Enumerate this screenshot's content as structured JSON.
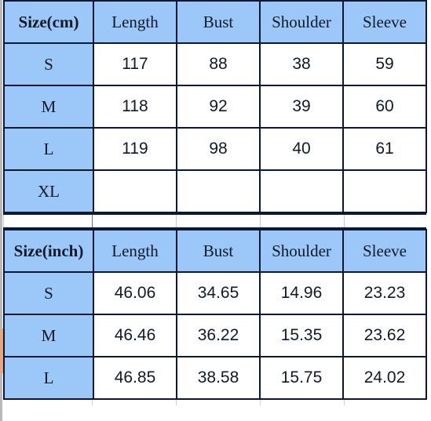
{
  "chart_data": {
    "type": "table",
    "title": "Garment size chart",
    "tables": [
      {
        "unit": "cm",
        "columns": [
          "Size(cm)",
          "Length",
          "Bust",
          "Shoulder",
          "Sleeve"
        ],
        "rows": [
          {
            "size": "S",
            "length": "117",
            "bust": "88",
            "shoulder": "38",
            "sleeve": "59"
          },
          {
            "size": "M",
            "length": "118",
            "bust": "92",
            "shoulder": "39",
            "sleeve": "60"
          },
          {
            "size": "L",
            "length": "119",
            "bust": "98",
            "shoulder": "40",
            "sleeve": "61"
          },
          {
            "size": "XL",
            "length": "",
            "bust": "",
            "shoulder": "",
            "sleeve": ""
          }
        ]
      },
      {
        "unit": "inch",
        "columns": [
          "Size(inch)",
          "Length",
          "Bust",
          "Shoulder",
          "Sleeve"
        ],
        "rows": [
          {
            "size": "S",
            "length": "46.06",
            "bust": "34.65",
            "shoulder": "14.96",
            "sleeve": "23.23"
          },
          {
            "size": "M",
            "length": "46.46",
            "bust": "36.22",
            "shoulder": "15.35",
            "sleeve": "23.62"
          },
          {
            "size": "L",
            "length": "46.85",
            "bust": "38.58",
            "shoulder": "15.75",
            "sleeve": "24.02"
          }
        ]
      }
    ],
    "colors": {
      "header_fill": "#9bc8f8",
      "cell_fill": "#ffffff",
      "border": "#0a1833",
      "row_marker": "#e8a87c",
      "gutter": "#b9b9b9"
    }
  },
  "cm_table": {
    "header": {
      "size": "Size(cm)",
      "length": "Length",
      "bust": "Bust",
      "shoulder": "Shoulder",
      "sleeve": "Sleeve"
    },
    "rows": [
      {
        "size": "S",
        "length": "117",
        "bust": "88",
        "shoulder": "38",
        "sleeve": "59"
      },
      {
        "size": "M",
        "length": "118",
        "bust": "92",
        "shoulder": "39",
        "sleeve": "60"
      },
      {
        "size": "L",
        "length": "119",
        "bust": "98",
        "shoulder": "40",
        "sleeve": "61"
      },
      {
        "size": "XL",
        "length": "",
        "bust": "",
        "shoulder": "",
        "sleeve": ""
      }
    ]
  },
  "inch_table": {
    "header": {
      "size": "Size(inch)",
      "length": "Length",
      "bust": "Bust",
      "shoulder": "Shoulder",
      "sleeve": "Sleeve"
    },
    "rows": [
      {
        "size": "S",
        "length": "46.06",
        "bust": "34.65",
        "shoulder": "14.96",
        "sleeve": "23.23"
      },
      {
        "size": "M",
        "length": "46.46",
        "bust": "36.22",
        "shoulder": "15.35",
        "sleeve": "23.62"
      },
      {
        "size": "L",
        "length": "46.85",
        "bust": "38.58",
        "shoulder": "15.75",
        "sleeve": "24.02"
      }
    ]
  }
}
